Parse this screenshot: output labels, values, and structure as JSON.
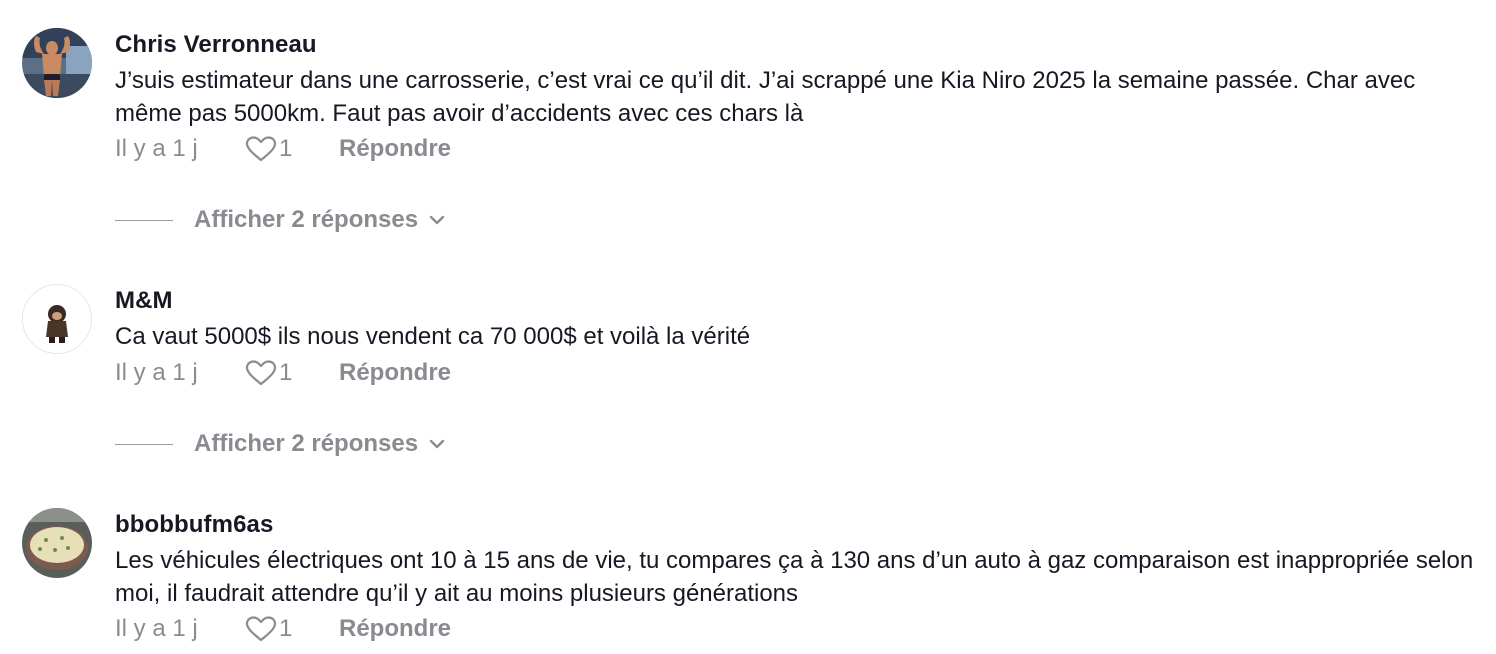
{
  "comments": [
    {
      "username": "Chris Verronneau",
      "text": "J’suis estimateur dans une carrosserie, c’est vrai ce qu’il dit. J’ai scrappé une Kia Niro 2025 la semaine passée. Char avec même pas 5000km. Faut pas avoir d’accidents avec ces chars là",
      "time": "Il y a 1 j",
      "likes": "1",
      "reply_label": "Répondre",
      "view_replies": "Afficher 2 réponses",
      "avatar_icon": "bodybuilder-photo"
    },
    {
      "username": "M&M",
      "text": "Ca vaut 5000$ ils nous vendent ca 70 000$ et voilà la vérité",
      "time": "Il y a 1 j",
      "likes": "1",
      "reply_label": "Répondre",
      "view_replies": "Afficher 2 réponses",
      "avatar_icon": "figurine-photo"
    },
    {
      "username": "bbobbufm6as",
      "text": "Les véhicules électriques ont 10 à 15 ans de vie, tu compares ça à 130 ans d’un auto à gaz comparaison est inappropriée selon moi, il faudrait attendre qu’il y ait au moins plusieurs générations",
      "time": "Il y a 1 j",
      "likes": "1",
      "reply_label": "Répondre",
      "avatar_icon": "food-photo"
    }
  ],
  "colors": {
    "text_primary": "#161823",
    "text_secondary": "#8a8b91"
  }
}
